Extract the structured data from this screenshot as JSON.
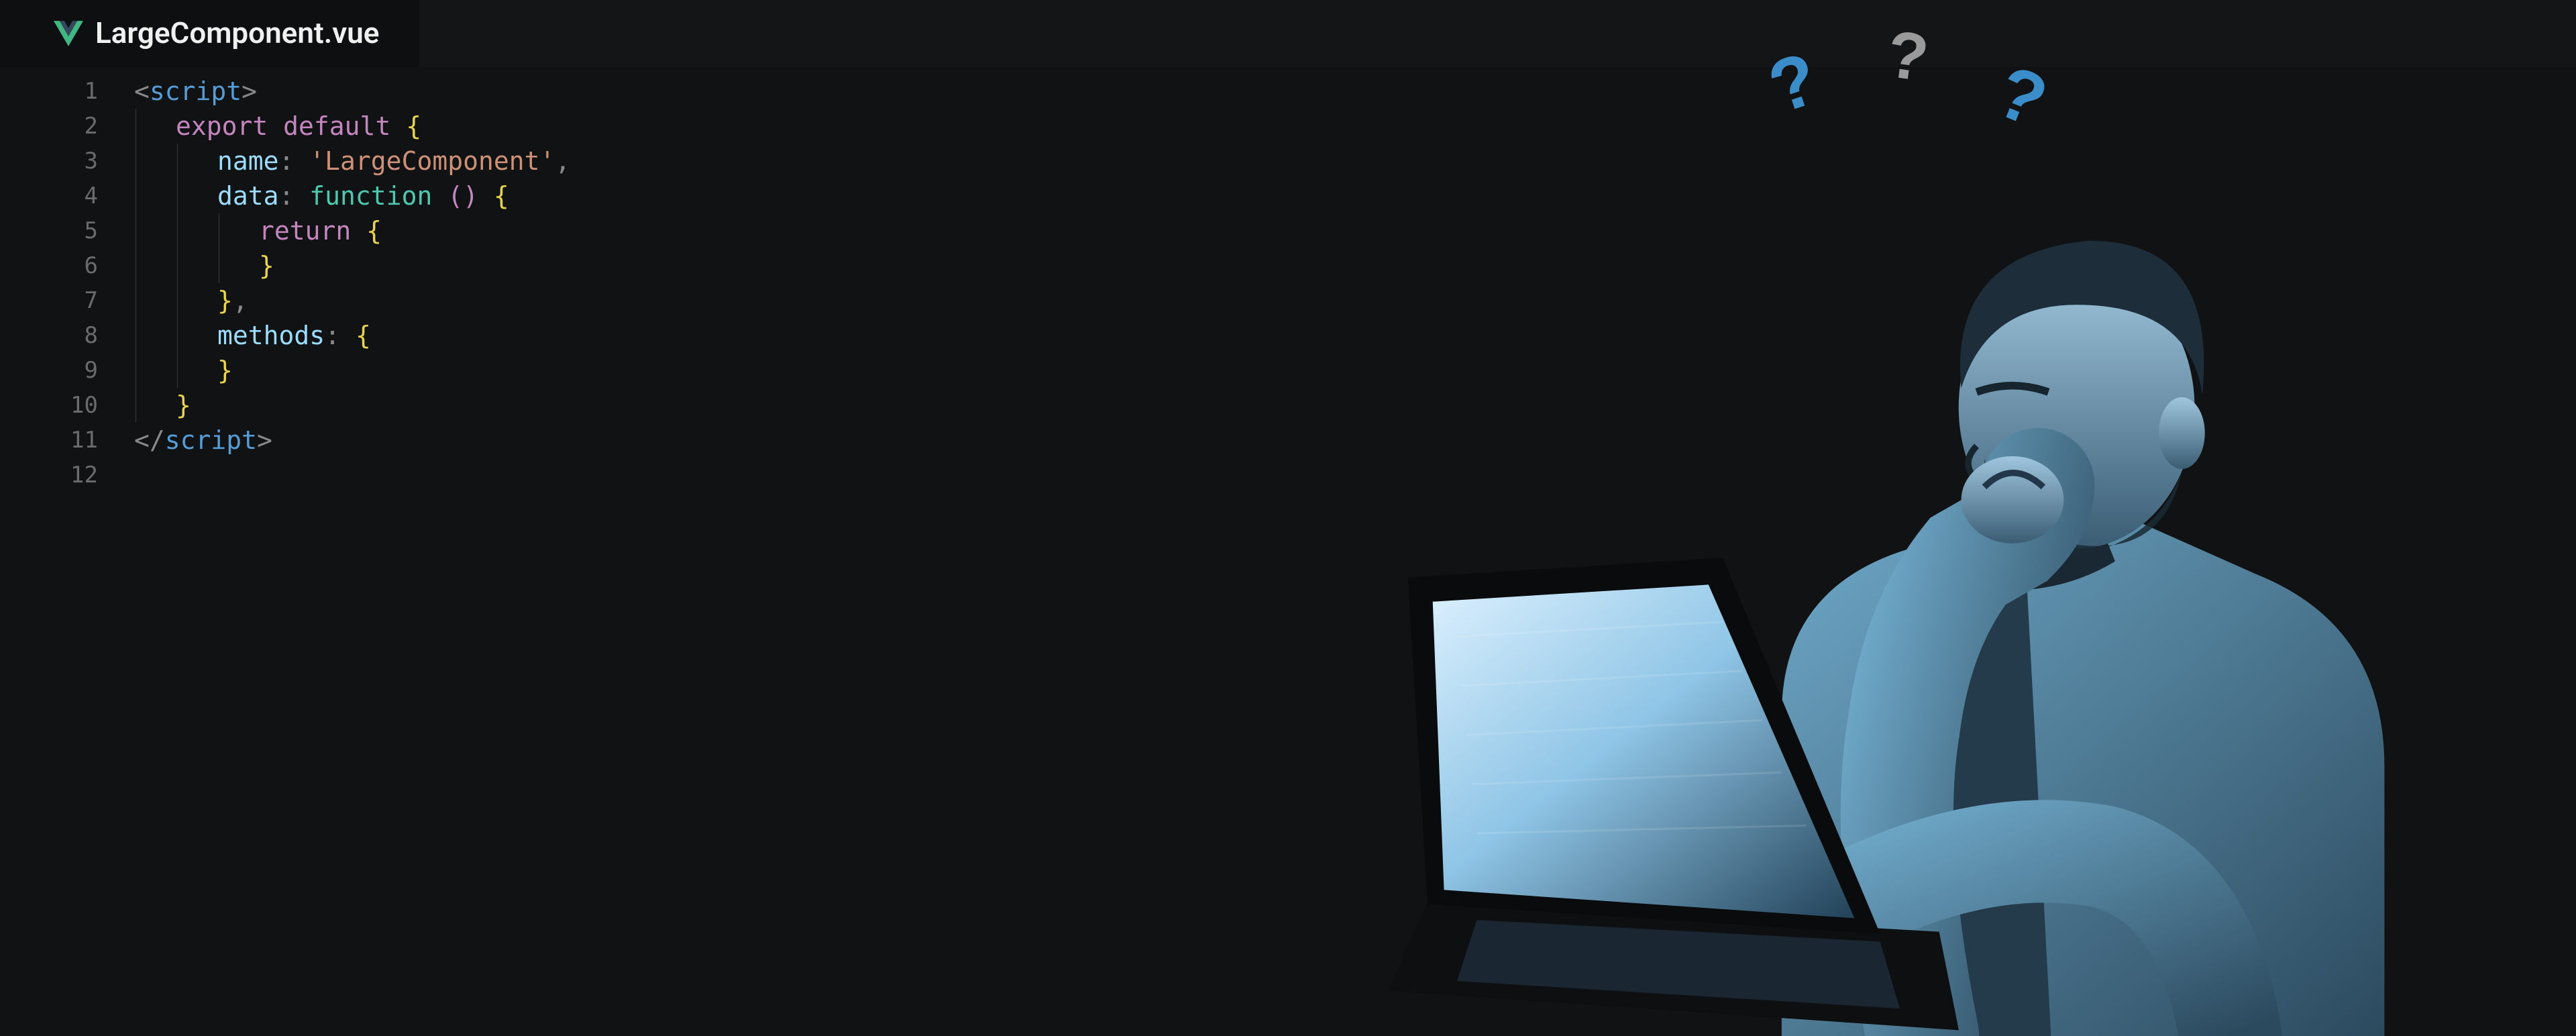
{
  "tab": {
    "filename": "LargeComponent.vue",
    "icon": "vue-file-icon"
  },
  "code": {
    "lines": [
      {
        "n": 1,
        "indent": 0,
        "tokens": [
          {
            "c": "t-punct",
            "t": "<"
          },
          {
            "c": "t-tag",
            "t": "script"
          },
          {
            "c": "t-punct",
            "t": ">"
          }
        ]
      },
      {
        "n": 2,
        "indent": 1,
        "tokens": [
          {
            "c": "t-keyword",
            "t": "export"
          },
          {
            "c": "",
            "t": " "
          },
          {
            "c": "t-keyword",
            "t": "default"
          },
          {
            "c": "",
            "t": " "
          },
          {
            "c": "t-brace",
            "t": "{"
          }
        ]
      },
      {
        "n": 3,
        "indent": 2,
        "tokens": [
          {
            "c": "t-prop",
            "t": "name"
          },
          {
            "c": "t-punct",
            "t": ":"
          },
          {
            "c": "",
            "t": " "
          },
          {
            "c": "t-string",
            "t": "'LargeComponent'"
          },
          {
            "c": "t-punct",
            "t": ","
          }
        ]
      },
      {
        "n": 4,
        "indent": 2,
        "tokens": [
          {
            "c": "t-prop",
            "t": "data"
          },
          {
            "c": "t-punct",
            "t": ":"
          },
          {
            "c": "",
            "t": " "
          },
          {
            "c": "t-func",
            "t": "function"
          },
          {
            "c": "",
            "t": " "
          },
          {
            "c": "t-paren",
            "t": "("
          },
          {
            "c": "t-paren",
            "t": ")"
          },
          {
            "c": "",
            "t": " "
          },
          {
            "c": "t-brace",
            "t": "{"
          }
        ]
      },
      {
        "n": 5,
        "indent": 3,
        "tokens": [
          {
            "c": "t-keyword",
            "t": "return"
          },
          {
            "c": "",
            "t": " "
          },
          {
            "c": "t-brace",
            "t": "{"
          }
        ]
      },
      {
        "n": 6,
        "indent": 3,
        "tokens": [
          {
            "c": "t-brace",
            "t": "}"
          }
        ]
      },
      {
        "n": 7,
        "indent": 2,
        "tokens": [
          {
            "c": "t-brace",
            "t": "}"
          },
          {
            "c": "t-punct",
            "t": ","
          }
        ]
      },
      {
        "n": 8,
        "indent": 2,
        "tokens": [
          {
            "c": "t-prop",
            "t": "methods"
          },
          {
            "c": "t-punct",
            "t": ":"
          },
          {
            "c": "",
            "t": " "
          },
          {
            "c": "t-brace",
            "t": "{"
          }
        ]
      },
      {
        "n": 9,
        "indent": 2,
        "tokens": [
          {
            "c": "t-brace",
            "t": "}"
          }
        ]
      },
      {
        "n": 10,
        "indent": 1,
        "tokens": [
          {
            "c": "t-brace",
            "t": "}"
          }
        ]
      },
      {
        "n": 11,
        "indent": 0,
        "tokens": [
          {
            "c": "t-punct",
            "t": "</"
          },
          {
            "c": "t-tag",
            "t": "script"
          },
          {
            "c": "t-punct",
            "t": ">"
          }
        ]
      },
      {
        "n": 12,
        "indent": 0,
        "tokens": []
      }
    ]
  },
  "illustration": {
    "q1": "?",
    "q2": "?",
    "q3": "?",
    "description": "confused-man-with-laptop"
  }
}
